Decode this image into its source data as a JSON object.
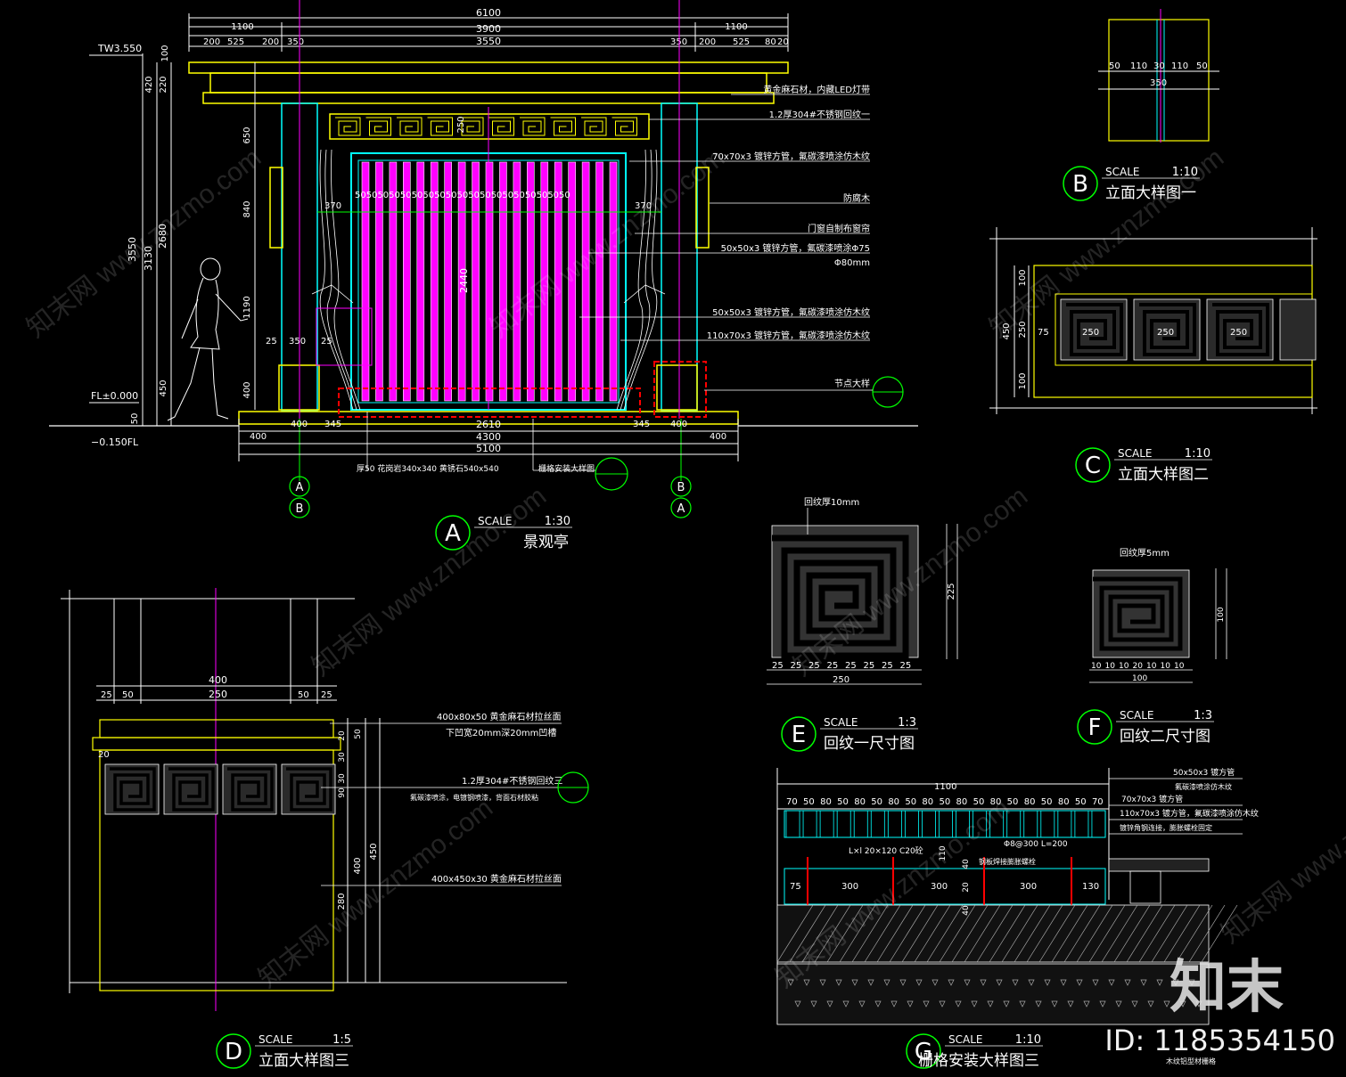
{
  "brand": {
    "name": "知末",
    "id": "ID: 1185354150",
    "watermark": "知末网 www.znzmo.com"
  },
  "details": {
    "A": {
      "letter": "A",
      "scale_label": "SCALE",
      "scale": "1:30",
      "title": "景观亭"
    },
    "B": {
      "letter": "B",
      "scale_label": "SCALE",
      "scale": "1:10",
      "title": "立面大样图一"
    },
    "C": {
      "letter": "C",
      "scale_label": "SCALE",
      "scale": "1:10",
      "title": "立面大样图二"
    },
    "D": {
      "letter": "D",
      "scale_label": "SCALE",
      "scale": "1:5",
      "title": "立面大样图三"
    },
    "E": {
      "letter": "E",
      "scale_label": "SCALE",
      "scale": "1:3",
      "title": "回纹一尺寸图"
    },
    "F": {
      "letter": "F",
      "scale_label": "SCALE",
      "scale": "1:3",
      "title": "回纹二尺寸图"
    },
    "G": {
      "letter": "G",
      "scale_label": "SCALE",
      "scale": "1:10",
      "title": "栅格安装大样图三"
    }
  },
  "elevation_A": {
    "dims_top": [
      "6100",
      "3900",
      "1100",
      "1100",
      "3550",
      "200",
      "525",
      "200",
      "350",
      "350",
      "200",
      "525",
      "80",
      "20"
    ],
    "dims_bottom": [
      "2610",
      "4300",
      "5100",
      "400",
      "400",
      "400",
      "400",
      "345",
      "345"
    ],
    "dims_left": [
      "3550",
      "3130",
      "2680",
      "420",
      "220",
      "100",
      "650",
      "840",
      "1190",
      "450",
      "400",
      "50"
    ],
    "levels": [
      "TW3.550",
      "FL±0.000",
      "−0.150FL"
    ],
    "center_dims": [
      "2440",
      "250",
      "370",
      "370",
      "25",
      "350",
      "25"
    ],
    "slat_dims": "50505050505050505050505050505050505050",
    "annotations": [
      "1.2厚304#不锈钢回纹一",
      "黄金麻石材，内藏LED灯带",
      "70x70x3 镀锌方管，氟碳漆喷涂仿木纹",
      "防腐木",
      "门窗自制布窗帘",
      "50x50x3 镀锌方管，氟碳漆喷涂Φ75",
      "Φ80mm",
      "50x50x3 镀锌方管，氟碳漆喷涂仿木纹",
      "110x70x3 镀锌方管，氟碳漆喷涂仿木纹",
      "节点大样",
      "厚50 花岗岩340x340 黄锈石540x540",
      "栅格安装大样图"
    ],
    "axes": [
      "A",
      "B",
      "B",
      "A"
    ]
  },
  "detail_B": {
    "dims": [
      "50",
      "110",
      "30",
      "110",
      "50",
      "350"
    ]
  },
  "detail_C": {
    "dims": [
      "450",
      "100",
      "250",
      "100",
      "75"
    ],
    "units": [
      "250",
      "250",
      "250"
    ]
  },
  "detail_D": {
    "dims_top": [
      "400",
      "250",
      "25",
      "50",
      "50",
      "25",
      "20"
    ],
    "dims_right": [
      "20",
      "30",
      "50",
      "30",
      "90",
      "450",
      "400",
      "280"
    ],
    "annotations": [
      "400x80x50 黄金麻石材拉丝面",
      "下凹宽20mm深20mm凹槽",
      "1.2厚304#不锈钢回纹三",
      "氟碳漆喷涂，电镀钢喷漆，背面石材胶粘",
      "400x450x30 黄金麻石材拉丝面"
    ]
  },
  "detail_E": {
    "label": "回纹厚10mm",
    "dims_bottom": [
      "25",
      "25",
      "25",
      "25",
      "25",
      "25",
      "25",
      "25",
      "250"
    ],
    "dims_right": [
      "225"
    ]
  },
  "detail_F": {
    "label": "回纹厚5mm",
    "dims_bottom": [
      "10",
      "10",
      "10",
      "20",
      "10",
      "10",
      "10",
      "100"
    ],
    "dims_right": [
      "100"
    ]
  },
  "detail_G": {
    "dims_top": [
      "1100"
    ],
    "slats": [
      "70",
      "50",
      "80",
      "50",
      "80",
      "50",
      "80",
      "50",
      "80",
      "50",
      "80",
      "50",
      "80",
      "50",
      "80",
      "50",
      "80",
      "50",
      "70"
    ],
    "dims_row": [
      "75",
      "300",
      "300",
      "300",
      "130",
      "110",
      "40",
      "20",
      "40"
    ],
    "annotations": [
      "50x50x3 镀方管",
      "氟碳漆喷涂仿木纹",
      "70x70x3 镀方管",
      "110x70x3 镀方管，氟碳漆喷涂仿木纹",
      "镀锌角钢连接，膨胀螺栓固定",
      "L×l 20×120 C20砼",
      "Φ8@300 L=200",
      "钢板焊接膨胀螺栓",
      "木纹铝型材栅格"
    ]
  },
  "colors": {
    "background": "#000000",
    "yellow": "#ffff00",
    "magenta": "#ff00ff",
    "cyan": "#00ffff",
    "green": "#00ff00",
    "red": "#ff0000",
    "white": "#ffffff",
    "orange": "#ff8800"
  }
}
